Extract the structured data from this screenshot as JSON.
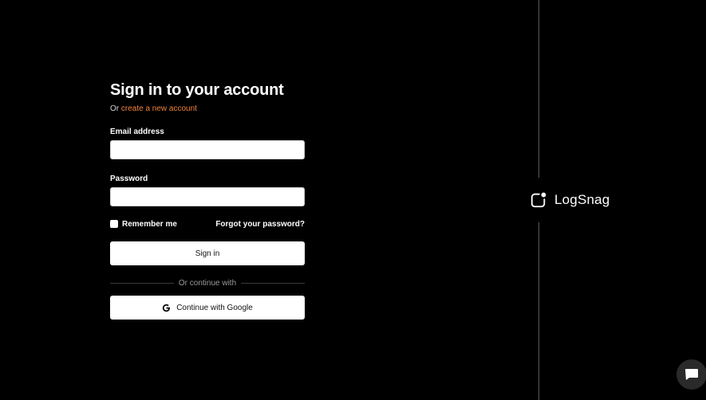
{
  "signin": {
    "title": "Sign in to your account",
    "subtitle_prefix": "Or",
    "create_account_link": "create a new account",
    "email_label": "Email address",
    "email_value": "",
    "password_label": "Password",
    "password_value": "",
    "remember_label": "Remember me",
    "forgot_label": "Forgot your password?",
    "signin_button": "Sign in",
    "divider_text": "Or continue with",
    "google_button": "Continue with Google"
  },
  "brand": {
    "name": "LogSnag"
  },
  "icons": {
    "google": "google-g-icon",
    "logo": "logsnag-logo-icon",
    "chat": "chat-bubble-icon"
  },
  "colors": {
    "background": "#000000",
    "accent_link": "#f0833a",
    "button_bg": "#ffffff"
  }
}
